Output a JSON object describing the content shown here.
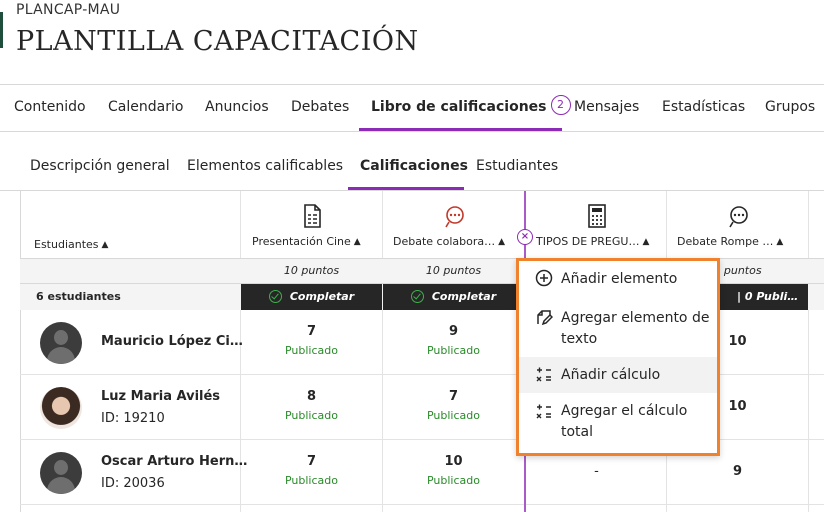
{
  "course": {
    "code": "PLANCAP-MAU",
    "title": "PLANTILLA CAPACITACIÓN"
  },
  "main_tabs": [
    {
      "label": "Contenido"
    },
    {
      "label": "Calendario"
    },
    {
      "label": "Anuncios"
    },
    {
      "label": "Debates"
    },
    {
      "label": "Libro de calificaciones",
      "badge": "2",
      "active": true
    },
    {
      "label": "Mensajes"
    },
    {
      "label": "Estadísticas"
    },
    {
      "label": "Grupos"
    }
  ],
  "sub_tabs": [
    {
      "label": "Descripción general"
    },
    {
      "label": "Elementos calificables"
    },
    {
      "label": "Calificaciones",
      "active": true
    },
    {
      "label": "Estudiantes"
    }
  ],
  "grid": {
    "students_header": "Estudiantes",
    "student_count": "6 estudiantes",
    "columns": [
      {
        "label": "Presentación Cine",
        "icon": "assignment-icon",
        "points": "10 puntos",
        "status": "Completar"
      },
      {
        "label": "Debate colabora…",
        "icon": "discussion-icon",
        "points": "10 puntos",
        "status": "Completar"
      },
      {
        "label": "TIPOS DE PREGU…",
        "icon": "calculator-icon",
        "points": "",
        "status": ""
      },
      {
        "label": "Debate Rompe …",
        "icon": "discussion-icon",
        "points": "0 puntos",
        "status": "| 0 Publi…"
      }
    ],
    "rows": [
      {
        "name": "Mauricio López Ci…",
        "id": "",
        "grades": [
          {
            "value": "7",
            "status": "Publicado"
          },
          {
            "value": "9",
            "status": "Publicado"
          },
          {
            "value": "",
            "status": ""
          },
          {
            "value": "10",
            "status": ""
          }
        ]
      },
      {
        "name": "Luz Maria Avilés",
        "id": "ID: 19210",
        "grades": [
          {
            "value": "8",
            "status": "Publicado"
          },
          {
            "value": "7",
            "status": "Publicado"
          },
          {
            "value": "",
            "status": ""
          },
          {
            "value": "10",
            "status": ""
          }
        ]
      },
      {
        "name": "Oscar Arturo Hern…",
        "id": "ID: 20036",
        "grades": [
          {
            "value": "7",
            "status": "Publicado"
          },
          {
            "value": "10",
            "status": "Publicado"
          },
          {
            "value": "-",
            "status": ""
          },
          {
            "value": "9",
            "status": ""
          }
        ]
      }
    ]
  },
  "add_menu": {
    "close_symbol": "×",
    "items": [
      {
        "label": "Añadir elemento",
        "icon": "plus-circle-icon"
      },
      {
        "label": "Agregar elemento de texto",
        "icon": "text-item-icon"
      },
      {
        "label": "Añadir cálculo",
        "icon": "calculation-icon"
      },
      {
        "label": "Agregar el cálculo total",
        "icon": "total-calculation-icon"
      }
    ]
  },
  "colors": {
    "accent": "#8c2bb5",
    "highlight_border": "#f0822d",
    "published": "#2b8a2b",
    "status_bar": "#262626"
  }
}
